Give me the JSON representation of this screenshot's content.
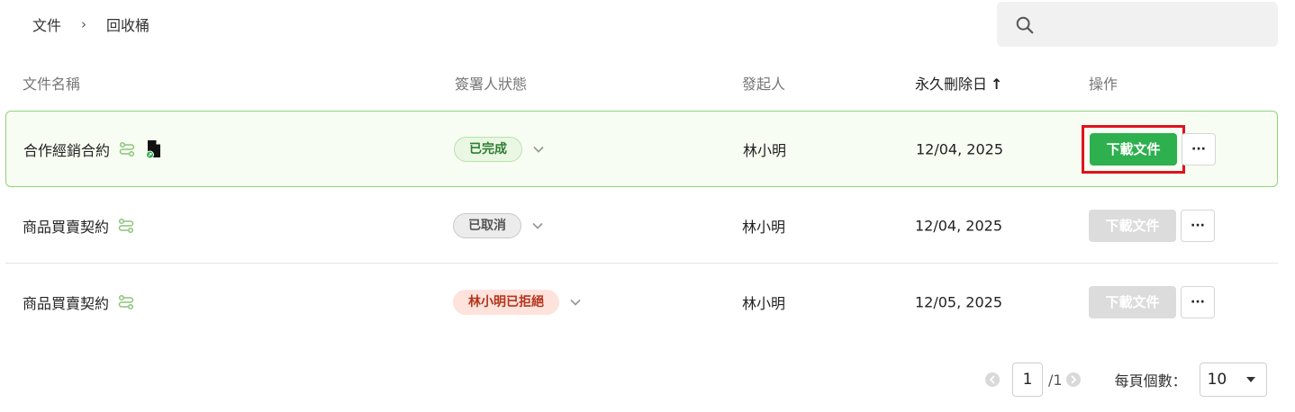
{
  "breadcrumb": {
    "root": "文件",
    "separator": "›",
    "current": "回收桶"
  },
  "search": {
    "placeholder": "",
    "value": ""
  },
  "table": {
    "headers": {
      "name": "文件名稱",
      "status": "簽署人狀態",
      "sender": "發起人",
      "delete_date": "永久刪除日",
      "actions": "操作"
    },
    "sort": {
      "column": "delete_date",
      "direction": "ascending",
      "arrow": "↑"
    },
    "rows": [
      {
        "name": "合作經銷合約",
        "has_attachment": true,
        "status": "已完成",
        "status_type": "done",
        "sender": "林小明",
        "date": "12/04, 2025",
        "download_label": "下載文件",
        "download_enabled": true,
        "more_label": "···"
      },
      {
        "name": "商品買賣契約",
        "has_attachment": false,
        "status": "已取消",
        "status_type": "cancel",
        "sender": "林小明",
        "date": "12/04, 2025",
        "download_label": "下載文件",
        "download_enabled": false,
        "more_label": "···"
      },
      {
        "name": "商品買賣契約",
        "has_attachment": false,
        "status": "林小明已拒絕",
        "status_type": "reject",
        "sender": "林小明",
        "date": "12/05, 2025",
        "download_label": "下載文件",
        "download_enabled": false,
        "more_label": "···"
      }
    ]
  },
  "pagination": {
    "current_page": "1",
    "total": "/1",
    "per_page_label": "每頁個數：",
    "per_page_value": "10"
  },
  "colors": {
    "accent_green": "#2eb04f",
    "highlight_border": "#8fd37a",
    "focus_outline": "#e0121b",
    "reject_text": "#b3341b"
  },
  "icons": {
    "search": "search-icon",
    "flow": "workflow-icon",
    "file": "file-link-icon",
    "chevron": "chevron-down-icon",
    "prev": "prev-page-icon",
    "next": "next-page-icon",
    "caret": "caret-down-icon"
  }
}
